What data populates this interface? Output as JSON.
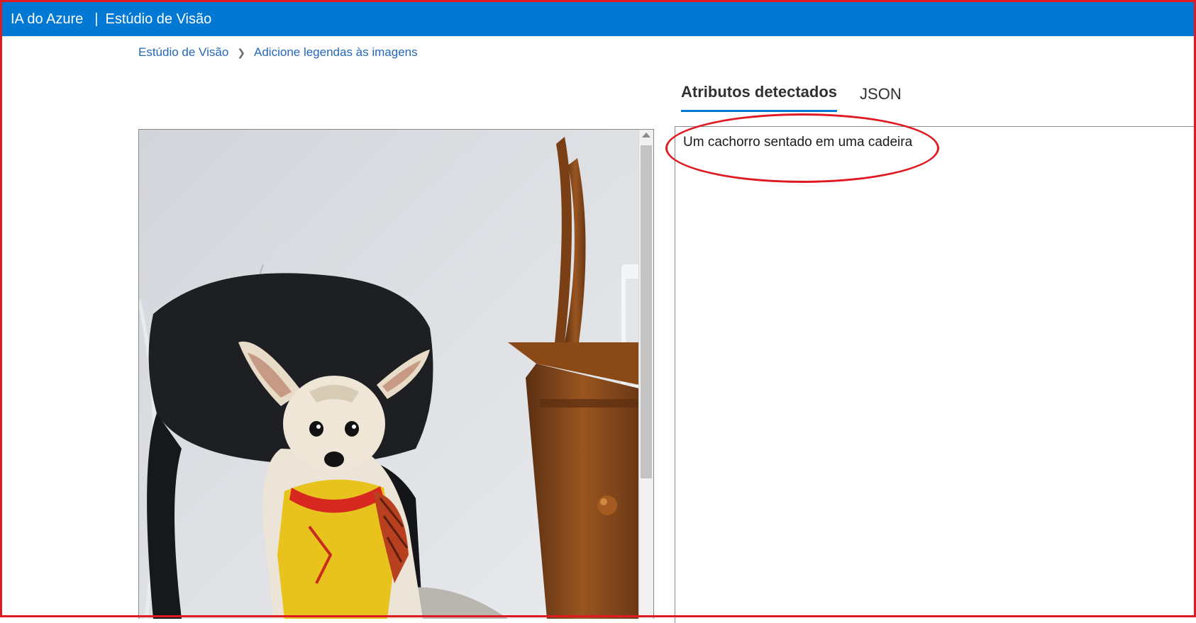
{
  "header": {
    "brand": "IA do Azure",
    "separator": "|",
    "product": "Estúdio de Visão"
  },
  "breadcrumb": {
    "home": "Estúdio de Visão",
    "current": "Adicione legendas às imagens"
  },
  "tabs": [
    {
      "label": "Atributos detectados",
      "active": true
    },
    {
      "label": "JSON",
      "active": false
    }
  ],
  "result": {
    "caption": "Um cachorro sentado em uma cadeira"
  },
  "colors": {
    "header_bg": "#0078d4",
    "link": "#2467b8",
    "annotation": "#e01a22"
  }
}
